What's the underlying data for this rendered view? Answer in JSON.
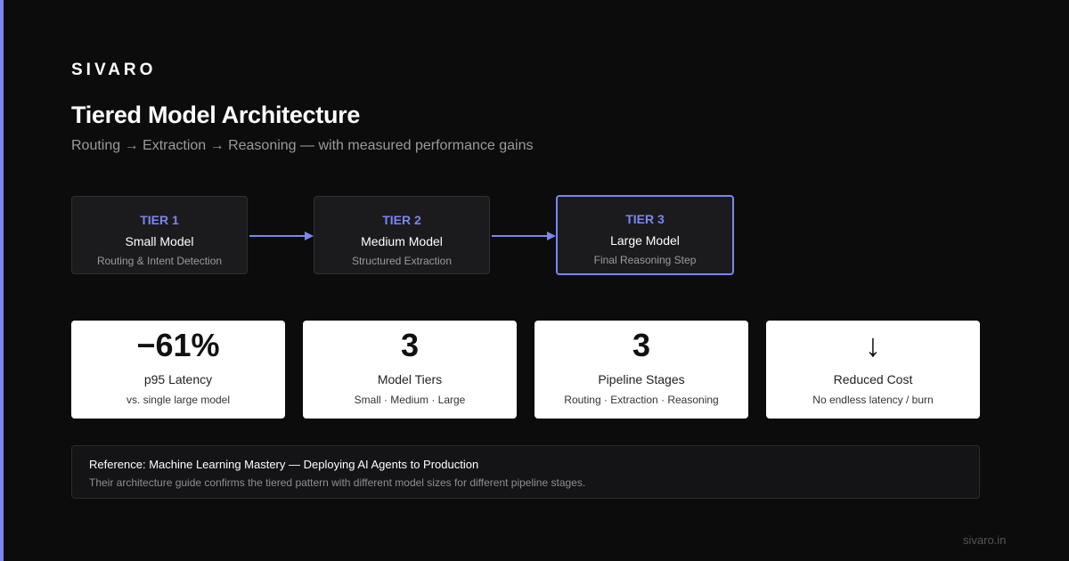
{
  "brand": "SIVARO",
  "title": "Tiered Model Architecture",
  "subtitle": "Routing → Extraction → Reasoning — with measured performance gains",
  "tiers": [
    {
      "label": "TIER 1",
      "name": "Small Model",
      "desc": "Routing & Intent Detection"
    },
    {
      "label": "TIER 2",
      "name": "Medium Model",
      "desc": "Structured Extraction"
    },
    {
      "label": "TIER 3",
      "name": "Large Model",
      "desc": "Final Reasoning Step"
    }
  ],
  "stats": [
    {
      "value": "−61%",
      "label": "p95 Latency",
      "sub": "vs. single large model"
    },
    {
      "value": "3",
      "label": "Model Tiers",
      "sub": "Small · Medium · Large"
    },
    {
      "value": "3",
      "label": "Pipeline Stages",
      "sub": "Routing · Extraction · Reasoning"
    },
    {
      "value": "↓",
      "label": "Reduced Cost",
      "sub": "No endless latency / burn"
    }
  ],
  "reference": {
    "title": "Reference: Machine Learning Mastery — Deploying AI Agents to Production",
    "body": "Their architecture guide confirms the tiered pattern with different model sizes for different pipeline stages."
  },
  "footer": "sivaro.in",
  "colors": {
    "accent": "#7b86f0",
    "background": "#0c0c0c",
    "card": "#ffffff"
  }
}
